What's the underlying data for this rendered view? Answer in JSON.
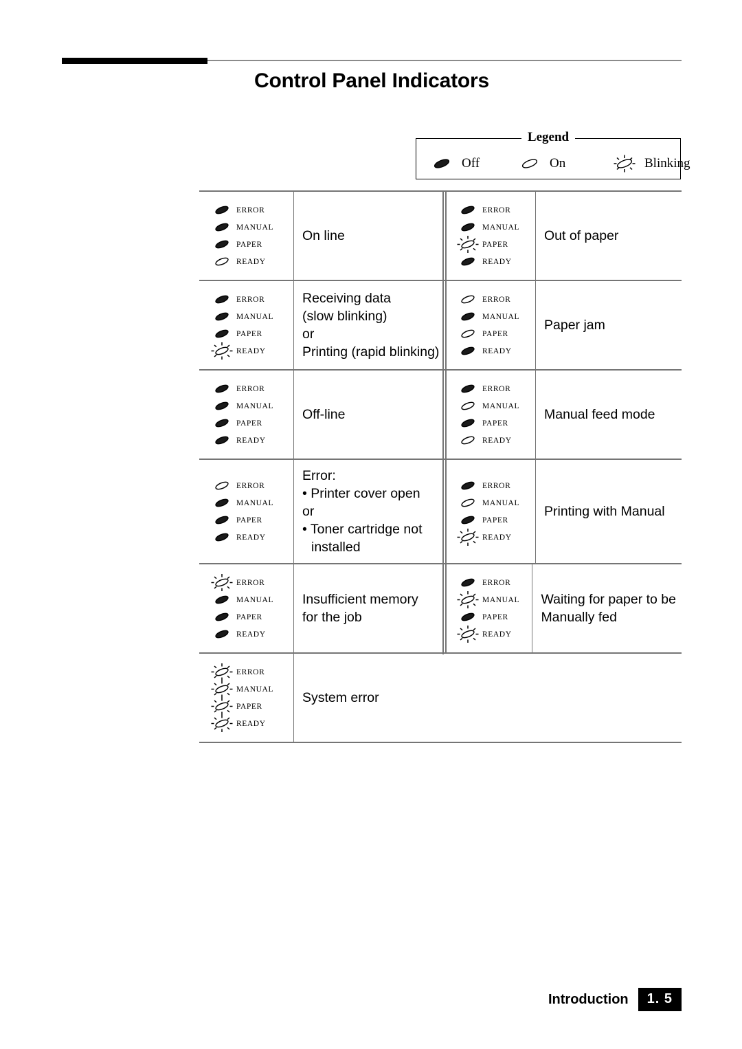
{
  "page": {
    "title": "Control Panel Indicators",
    "footer_label": "Introduction",
    "footer_page": "1. 5"
  },
  "legend": {
    "title": "Legend",
    "items": [
      {
        "state": "off",
        "label": "Off"
      },
      {
        "state": "on",
        "label": "On"
      },
      {
        "state": "blinking",
        "label": "Blinking"
      }
    ]
  },
  "led_names": [
    "ERROR",
    "MANUAL",
    "PAPER",
    "READY"
  ],
  "table": {
    "rows": [
      {
        "left": {
          "leds": [
            "off",
            "off",
            "off",
            "on"
          ],
          "lines": [
            "On line"
          ]
        },
        "right": {
          "leds": [
            "off",
            "off",
            "blinking",
            "off"
          ],
          "lines": [
            "Out of paper"
          ]
        }
      },
      {
        "left": {
          "leds": [
            "off",
            "off",
            "off",
            "blinking"
          ],
          "lines": [
            "Receiving data",
            "(slow blinking)",
            "or",
            "Printing (rapid blinking)"
          ]
        },
        "right": {
          "leds": [
            "on",
            "off",
            "on",
            "off"
          ],
          "lines": [
            "Paper jam"
          ]
        }
      },
      {
        "left": {
          "leds": [
            "off",
            "off",
            "off",
            "off"
          ],
          "lines": [
            "Off-line"
          ]
        },
        "right": {
          "leds": [
            "off",
            "on",
            "off",
            "on"
          ],
          "lines": [
            "Manual feed mode"
          ]
        }
      },
      {
        "left": {
          "leds": [
            "on",
            "off",
            "off",
            "off"
          ],
          "lines": [
            "Error:",
            "• Printer cover open",
            "or",
            "• Toner cartridge not",
            "installed"
          ]
        },
        "right": {
          "leds": [
            "off",
            "on",
            "off",
            "blinking"
          ],
          "lines": [
            "Printing with Manual"
          ]
        }
      },
      {
        "left": {
          "leds": [
            "blinking",
            "off",
            "off",
            "off"
          ],
          "lines": [
            "Insufficient memory",
            "for the job"
          ]
        },
        "right": {
          "leds": [
            "off",
            "blinking",
            "off",
            "blinking"
          ],
          "lines": [
            "Waiting for paper to be",
            "Manually fed"
          ]
        }
      },
      {
        "left": {
          "leds": [
            "blinking",
            "blinking",
            "blinking",
            "blinking"
          ],
          "lines": [
            "System error"
          ]
        },
        "right": null
      }
    ]
  }
}
